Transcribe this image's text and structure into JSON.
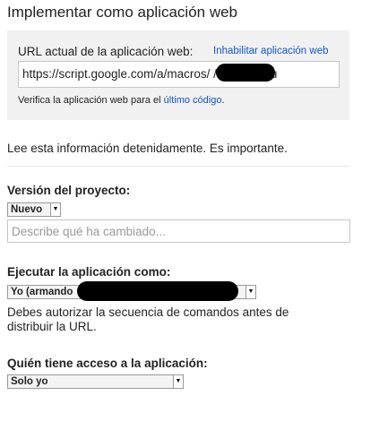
{
  "dialog": {
    "title": "Implementar como aplicación web"
  },
  "url_section": {
    "label": "URL actual de la aplicación web:",
    "disable_link": "Inhabilitar aplicación web",
    "url_value": "https://script.google.com/a/macros/                /s/AKfycbyu",
    "verify_prefix": "Verifica la aplicación web para el ",
    "verify_link": "último código",
    "verify_suffix": "."
  },
  "info_text": "Lee esta información detenidamente. Es importante.",
  "project_version": {
    "label": "Versión del proyecto:",
    "selected": "Nuevo",
    "description_placeholder": "Describe qué ha cambiado..."
  },
  "execute_as": {
    "label": "Ejecutar la aplicación como:",
    "selected": "Yo (armando",
    "note": "Debes autorizar la secuencia de comandos antes de distribuir la URL."
  },
  "access": {
    "label": "Quién tiene acceso a la aplicación:",
    "selected": "Solo yo"
  },
  "colors": {
    "link": "#1155cc",
    "panel_background": "#f1f1f1",
    "text": "#222222"
  },
  "icons": {
    "dropdown": "triangle-down"
  }
}
